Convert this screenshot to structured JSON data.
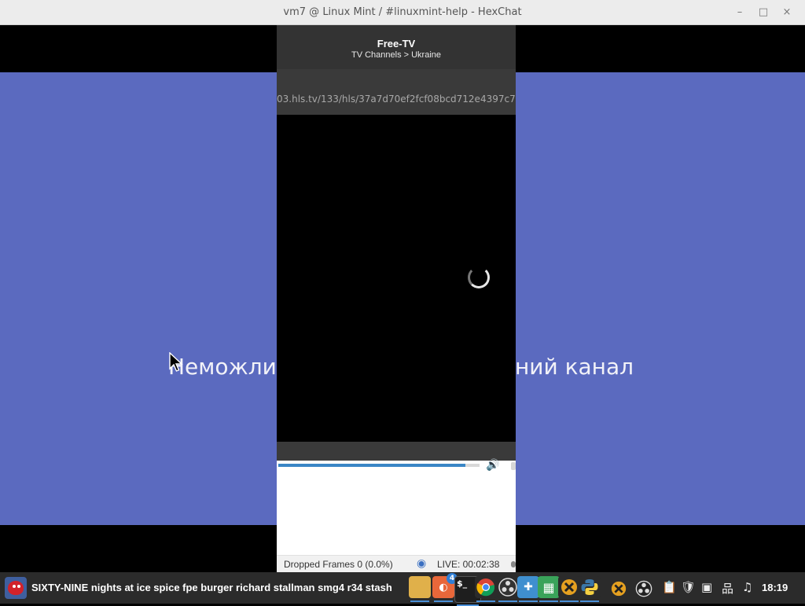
{
  "window": {
    "title": "vm7 @ Linux Mint / #linuxmint-help - HexChat",
    "minimize_glyph": "–",
    "maximize_glyph": "□",
    "close_glyph": "×"
  },
  "background_video": {
    "message_left": "Неможли",
    "message_right": "ний канал"
  },
  "player": {
    "header_title": "Free-TV",
    "header_subtitle": "TV Channels > Ukraine",
    "url": "03.hls.tv/133/hls/37a7d70ef2fcf08bcd712e4397c7",
    "progress_fraction": 0.93,
    "volume_icon": "speaker-icon",
    "status": {
      "dropped_frames": "Dropped Frames 0 (0.0%)",
      "live_icon": "broadcast-icon",
      "live_time": "LIVE: 00:02:38"
    }
  },
  "taskbar": {
    "window_label": "SIXTY-NINE nights at ice spice fpe burger richard stallman smg4 r34 stash",
    "files_badge": "4",
    "terminal_glyph": "$_",
    "clock": "18:19",
    "tray_icons": [
      "obs-icon",
      "clipboard-icon",
      "shield-icon",
      "update-icon",
      "network-icon",
      "music-icon"
    ]
  },
  "colors": {
    "blue_background": "#5b6abf",
    "player_header": "#333333",
    "progress": "#3a86c6"
  }
}
